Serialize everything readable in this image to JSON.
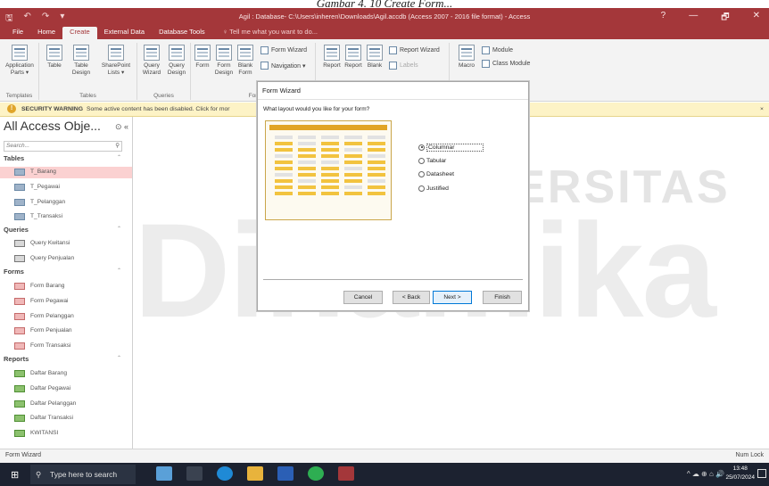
{
  "caption": "Gambar 4. 10 Create Form...",
  "window": {
    "title": "Agil : Database- C:\\Users\\inheren\\Downloads\\Agil.accdb (Access 2007 - 2016 file format) - Access",
    "controls": [
      "?",
      "—",
      "🗗",
      "✕"
    ]
  },
  "tabs": [
    "File",
    "Home",
    "Create",
    "External Data",
    "Database Tools"
  ],
  "active_tab": "Create",
  "tell_me": "Tell me what you want to do...",
  "ribbon": {
    "templates": {
      "label": "Templates",
      "app_parts": "Application Parts ▾"
    },
    "tables": {
      "label": "Tables",
      "table": "Table",
      "table_design": "Table Design",
      "sharepoint": "SharePoint Lists ▾"
    },
    "queries": {
      "label": "Queries",
      "wizard": "Query Wizard",
      "design": "Query Design"
    },
    "forms": {
      "label": "For",
      "form": "Form",
      "form_design": "Form Design",
      "blank": "Blank Form",
      "form_wizard": "Form Wizard",
      "navigation": "Navigation ▾"
    },
    "reports": {
      "report_wizard": "Report Wizard",
      "report": "Report",
      "report_design": "Report",
      "blank": "Blank",
      "labels": "Labels"
    },
    "macros": {
      "macro": "Macro",
      "module": "Module",
      "class_module": "Class Module"
    }
  },
  "security": {
    "title": "SECURITY WARNING",
    "text": "Some active content has been disabled. Click for mor"
  },
  "nav": {
    "title": "All Access Obje...",
    "search_placeholder": "Search...",
    "groups": [
      {
        "name": "Tables",
        "items": [
          "T_Barang",
          "T_Pegawai",
          "T_Pelanggan",
          "T_Transaksi"
        ]
      },
      {
        "name": "Queries",
        "items": [
          "Query Kwitansi",
          "Query Penjualan"
        ]
      },
      {
        "name": "Forms",
        "items": [
          "Form Barang",
          "Form Pegawai",
          "Form Pelanggan",
          "Form Penjualan",
          "Form Transaksi"
        ]
      },
      {
        "name": "Reports",
        "items": [
          "Daftar Barang",
          "Daftar Pegawai",
          "Daftar Pelanggan",
          "Daftar Transaksi",
          "KWITANSI"
        ]
      }
    ],
    "selected": "T_Barang"
  },
  "watermark": {
    "small": "UNIVERSITAS",
    "big": "Dinamika"
  },
  "dialog": {
    "title": "Form Wizard",
    "prompt": "What layout would you like for your form?",
    "options": [
      "Columnar",
      "Tabular",
      "Datasheet",
      "Justified"
    ],
    "selected": "Columnar",
    "buttons": {
      "cancel": "Cancel",
      "back": "< Back",
      "next": "Next >",
      "finish": "Finish"
    }
  },
  "status": {
    "left": "Form Wizard",
    "right": "Num Lock"
  },
  "taskbar": {
    "search": "Type here to search",
    "time": "13:48",
    "date": "25/07/2024",
    "tray": "^ ☁ ⊕ ⌂ 🔊"
  },
  "colors": {
    "accent": "#a4373a",
    "warning_bg": "#fdf3c6",
    "selection": "#fbd1d1"
  }
}
